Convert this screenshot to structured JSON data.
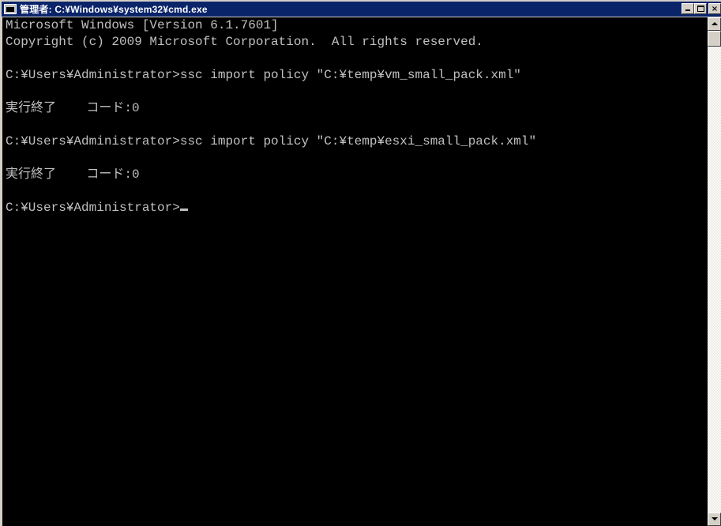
{
  "window": {
    "title": "管理者: C:¥Windows¥system32¥cmd.exe",
    "icon": "console-icon",
    "controls": [
      "minimize",
      "maximize",
      "close"
    ]
  },
  "colors": {
    "titlebar": "#0a246a",
    "console_bg": "#000000",
    "console_fg": "#c0c0c0"
  },
  "console": {
    "lines": [
      "Microsoft Windows [Version 6.1.7601]",
      "Copyright (c) 2009 Microsoft Corporation.  All rights reserved.",
      "",
      "C:¥Users¥Administrator>ssc import policy ″C:¥temp¥vm_small_pack.xml″",
      "",
      "実行終了    コード:0",
      "",
      "C:¥Users¥Administrator>ssc import policy ″C:¥temp¥esxi_small_pack.xml″",
      "",
      "実行終了    コード:0",
      "",
      "C:¥Users¥Administrator>"
    ]
  }
}
